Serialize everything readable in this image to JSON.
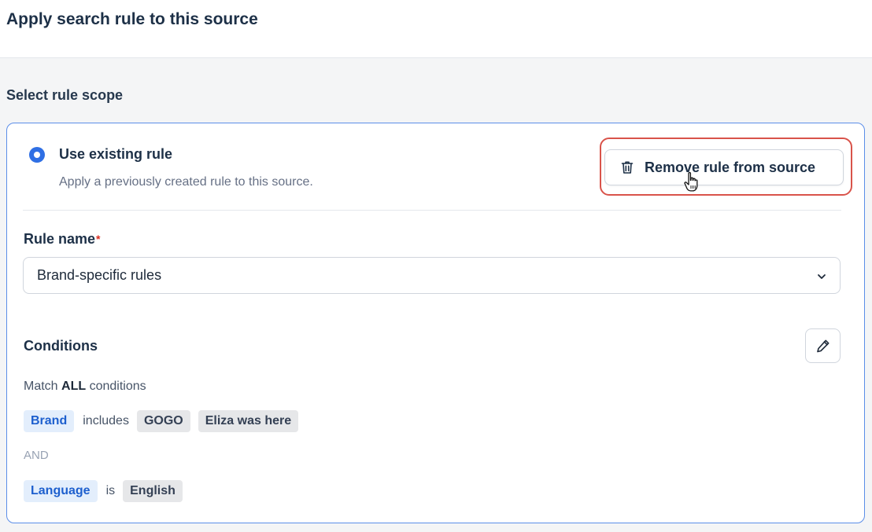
{
  "header": {
    "title": "Apply search rule to this source"
  },
  "scope": {
    "title": "Select rule scope"
  },
  "option": {
    "title": "Use existing rule",
    "description": "Apply a previously created rule to this source.",
    "selected": true
  },
  "remove_button": {
    "label": "Remove rule from source",
    "icon": "trash-icon"
  },
  "rule_name": {
    "label": "Rule name",
    "required_mark": "*",
    "value": "Brand-specific rules"
  },
  "conditions": {
    "title": "Conditions",
    "edit_icon": "pencil-icon",
    "match_prefix": "Match",
    "match_mode": "ALL",
    "match_suffix": "conditions",
    "joiner": "AND",
    "rows": [
      {
        "field": "Brand",
        "operator": "includes",
        "values": [
          "GOGO",
          "Eliza was here"
        ]
      },
      {
        "field": "Language",
        "operator": "is",
        "values": [
          "English"
        ]
      }
    ]
  },
  "colors": {
    "accent": "#2f6fe4",
    "card_border": "#5b8ee8",
    "highlight": "#d9534a",
    "chip_blue_bg": "#e3eefc",
    "chip_blue_text": "#1d5fce"
  }
}
